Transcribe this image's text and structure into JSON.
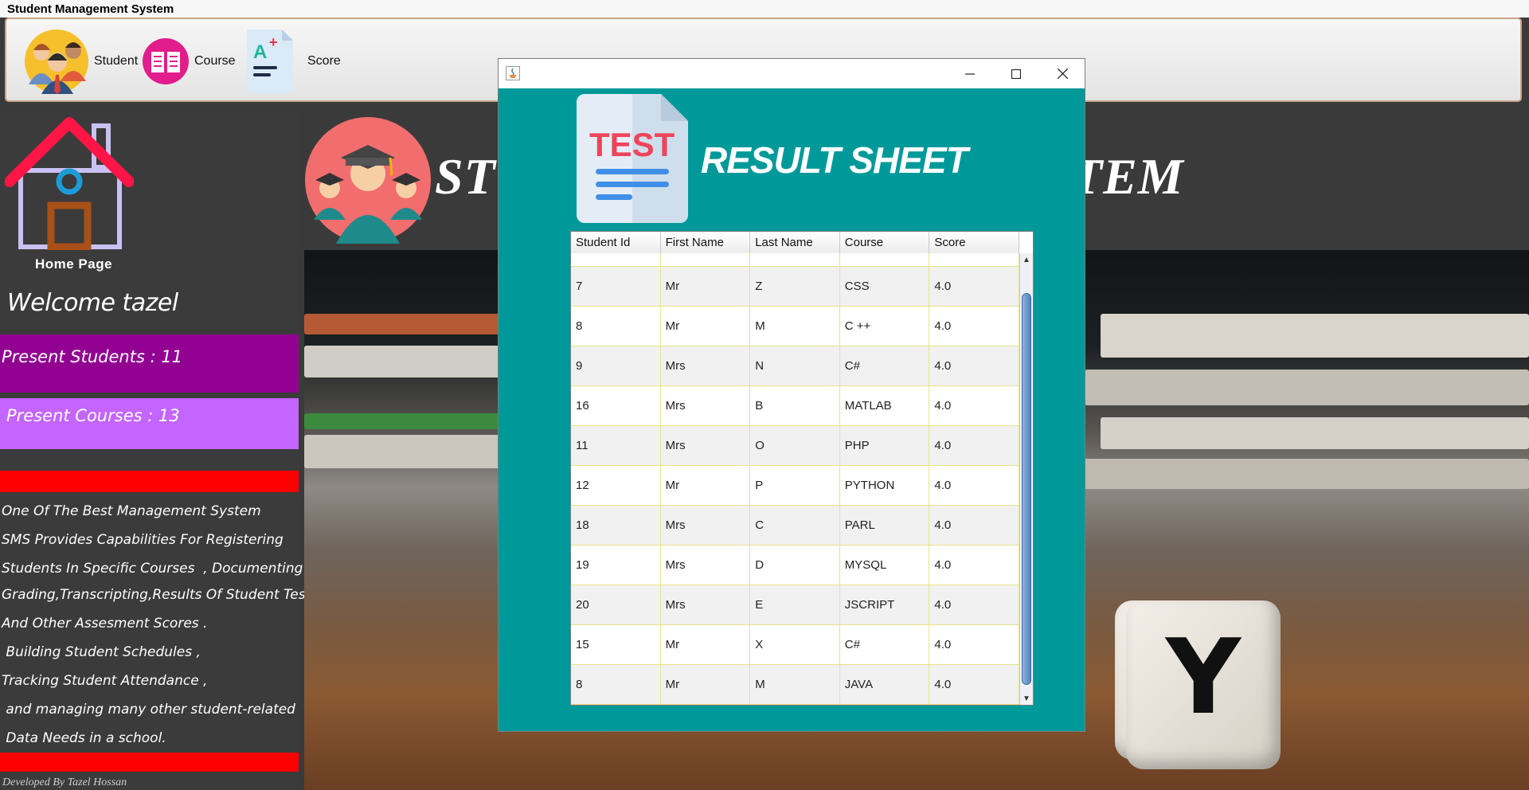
{
  "app": {
    "title": "Student Management System"
  },
  "toolbar": {
    "items": [
      {
        "label": "Student",
        "icon": "students-icon"
      },
      {
        "label": "Course",
        "icon": "book-icon"
      },
      {
        "label": "Score",
        "icon": "grade-icon"
      }
    ]
  },
  "sidebar": {
    "home_label": "Home Page",
    "welcome": "Welcome tazel",
    "present_students": "Present Students : 11",
    "present_courses": " Present Courses : 13",
    "description": [
      "One Of The Best Management System",
      "SMS Provides Capabilities For Registering",
      "Students In Specific Courses  , Documenting",
      "Grading,Transcripting,Results Of Student Tests",
      "And Other Assesment Scores .",
      " Building Student Schedules ,",
      "Tracking Student Attendance ,",
      " and managing many other student-related",
      " Data Needs in a school."
    ],
    "footer": "Developed By Tazel Hossan",
    "colors": {
      "students_bg": "#920092",
      "courses_bg": "#c465ff",
      "red_bar": "#ff0000"
    }
  },
  "banner": {
    "title_left": "STU",
    "title_right": "TEM"
  },
  "dialog": {
    "title": "RESULT SHEET",
    "icon_text": "TEST",
    "background": "#009999",
    "columns": [
      "Student Id",
      "First Name",
      "Last Name",
      "Course",
      "Score"
    ],
    "rows": [
      [
        "7",
        "Mr",
        "Z",
        "CSS",
        "4.0"
      ],
      [
        "8",
        "Mr",
        "M",
        "C ++",
        "4.0"
      ],
      [
        "9",
        "Mrs",
        "N",
        "C#",
        "4.0"
      ],
      [
        "16",
        "Mrs",
        "B",
        "MATLAB",
        "4.0"
      ],
      [
        "11",
        "Mrs",
        "O",
        "PHP",
        "4.0"
      ],
      [
        "12",
        "Mr",
        "P",
        "PYTHON",
        "4.0"
      ],
      [
        "18",
        "Mrs",
        "C",
        "PARL",
        "4.0"
      ],
      [
        "19",
        "Mrs",
        "D",
        "MYSQL",
        "4.0"
      ],
      [
        "20",
        "Mrs",
        "E",
        "JSCRIPT",
        "4.0"
      ],
      [
        "15",
        "Mr",
        "X",
        "C#",
        "4.0"
      ],
      [
        "8",
        "Mr",
        "M",
        "JAVA",
        "4.0"
      ]
    ]
  },
  "photo": {
    "cube_letter": "Y"
  }
}
